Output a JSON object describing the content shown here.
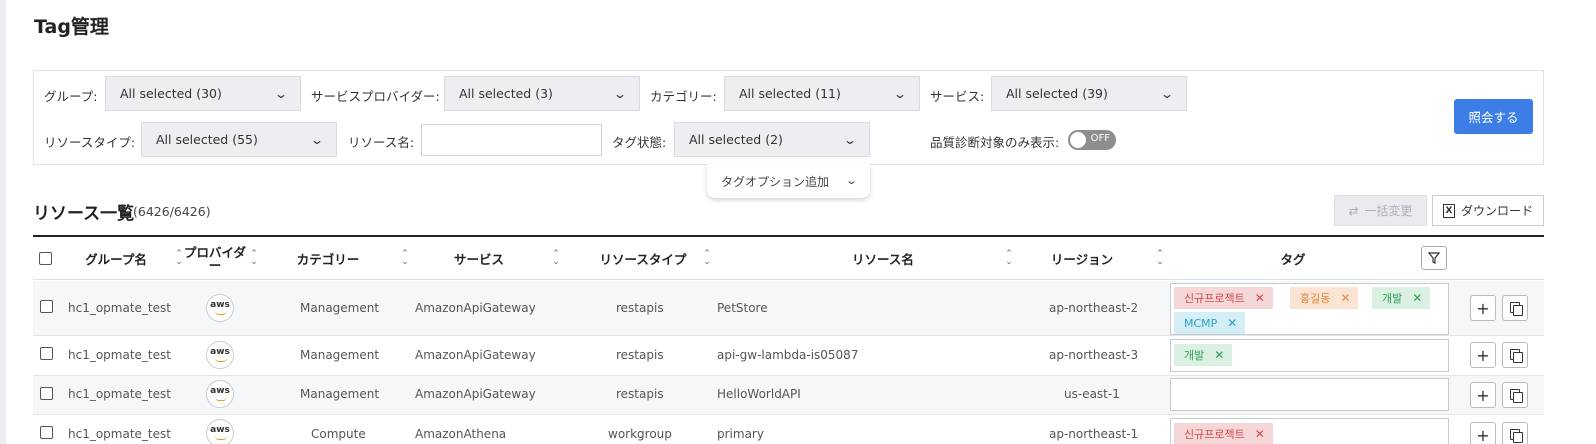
{
  "title": "Tag管理",
  "filters": {
    "group": {
      "label": "グループ:",
      "value": "All selected (30)"
    },
    "provider": {
      "label": "サービスプロバイダー:",
      "value": "All selected (3)"
    },
    "category": {
      "label": "カテゴリー:",
      "value": "All selected (11)"
    },
    "service": {
      "label": "サービス:",
      "value": "All selected (39)"
    },
    "resource_type": {
      "label": "リソースタイプ:",
      "value": "All selected (55)"
    },
    "resource_name": {
      "label": "リソース名:",
      "value": ""
    },
    "tag_status": {
      "label": "タグ状態:",
      "value": "All selected (2)"
    },
    "quality_only": {
      "label": "品質診断対象のみ表示:",
      "state": "OFF"
    },
    "search_button": "照会する",
    "tag_option": "タグオプション追加"
  },
  "list": {
    "title": "リソース一覧",
    "count": "(6426/6426)",
    "bulk_button": "一括変更",
    "download_button": "ダウンロード"
  },
  "columns": {
    "group": "グループ名",
    "provider": "プロバイダー",
    "category": "カテゴリー",
    "service": "サービス",
    "resource_type": "リソースタイプ",
    "resource_name": "リソース名",
    "region": "リージョン",
    "tag": "タグ"
  },
  "rows": [
    {
      "group": "hc1_opmate_test",
      "provider": "aws",
      "category": "Management",
      "service": "AmazonApiGateway",
      "type": "restapis",
      "name": "PetStore",
      "region": "ap-northeast-2",
      "tags": [
        {
          "text": "신규프로젝트",
          "color": "red"
        },
        {
          "text": "홍길동",
          "color": "orange"
        },
        {
          "text": "개발",
          "color": "green"
        },
        {
          "text": "MCMP",
          "color": "blue"
        }
      ]
    },
    {
      "group": "hc1_opmate_test",
      "provider": "aws",
      "category": "Management",
      "service": "AmazonApiGateway",
      "type": "restapis",
      "name": "api-gw-lambda-is05087",
      "region": "ap-northeast-3",
      "tags": [
        {
          "text": "개발",
          "color": "green"
        }
      ]
    },
    {
      "group": "hc1_opmate_test",
      "provider": "aws",
      "category": "Management",
      "service": "AmazonApiGateway",
      "type": "restapis",
      "name": "HelloWorldAPI",
      "region": "us-east-1",
      "tags": []
    },
    {
      "group": "hc1_opmate_test",
      "provider": "aws",
      "category": "Compute",
      "service": "AmazonAthena",
      "type": "workgroup",
      "name": "primary",
      "region": "ap-northeast-1",
      "tags": [
        {
          "text": "신규프로젝트",
          "color": "red"
        }
      ]
    }
  ],
  "colors": {
    "primary": "#3c7ee6",
    "tag_red": "#d24b4b",
    "tag_orange": "#e08a3c",
    "tag_green": "#33a05a",
    "tag_blue": "#2a9fc4"
  }
}
